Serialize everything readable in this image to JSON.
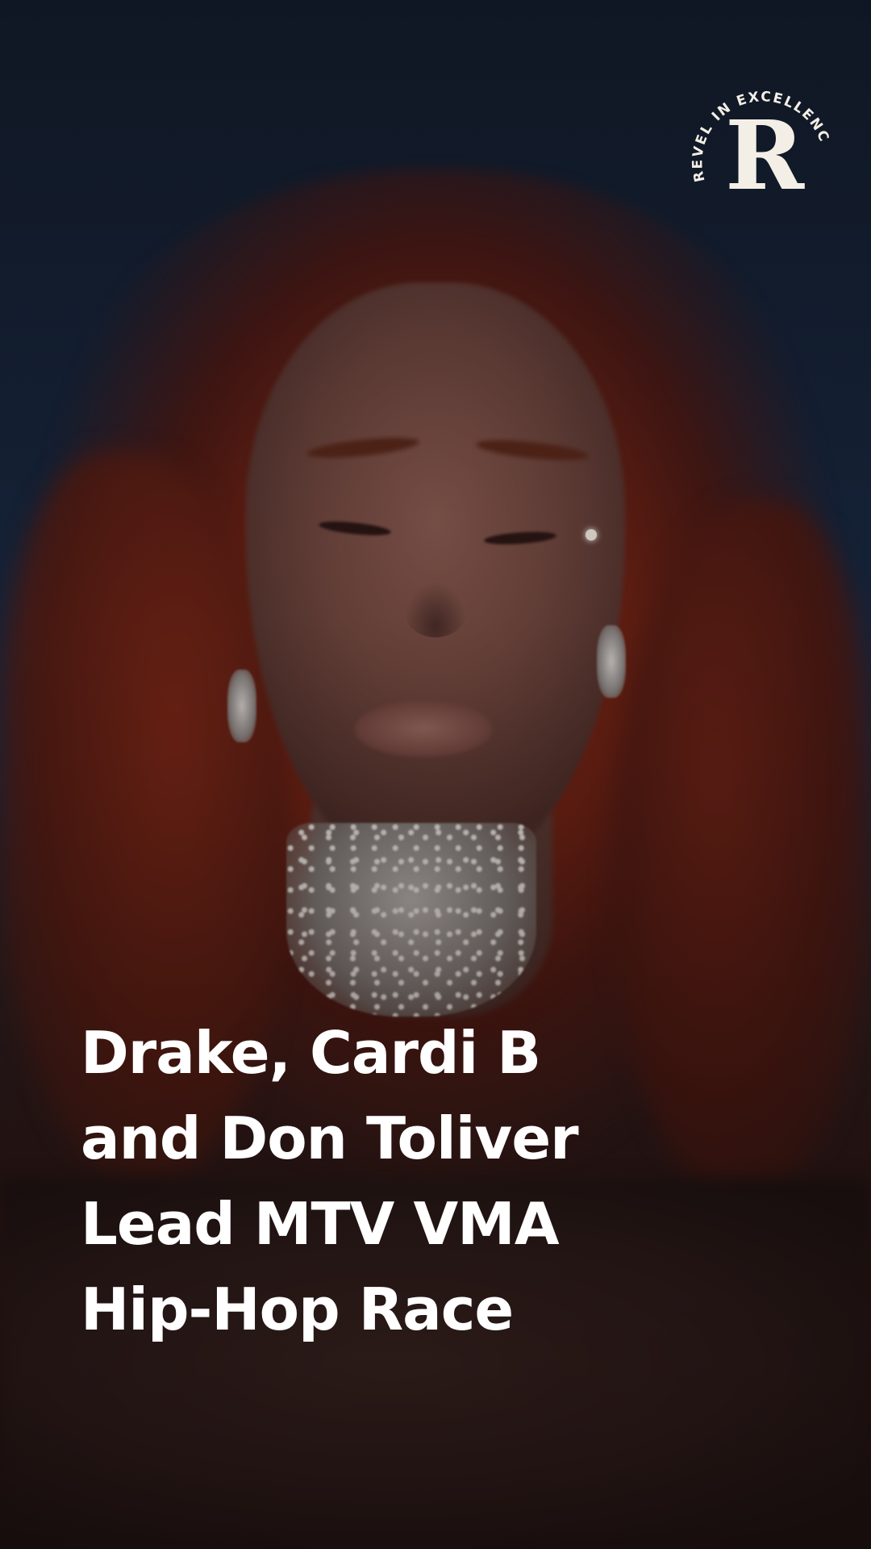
{
  "post": {
    "headline_lines": [
      "Drake, Cardi B",
      "and Don Toliver",
      "Lead MTV VMA",
      "Hip-Hop Race"
    ]
  },
  "logo": {
    "ring_text": "REVEL IN EXCELLENCE",
    "monogram": "R",
    "color": "#f3efe6"
  },
  "photo": {
    "subject": "woman with red hair and diamond jewelry"
  }
}
